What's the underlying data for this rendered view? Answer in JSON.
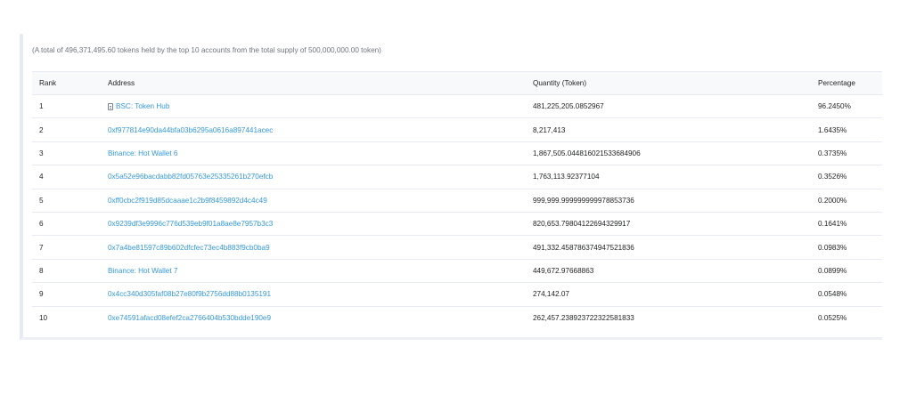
{
  "summary": "(A total of 496,371,495.60 tokens held by the top 10 accounts from the total supply of 500,000,000.00 token)",
  "table": {
    "headers": {
      "rank": "Rank",
      "address": "Address",
      "quantity": "Quantity (Token)",
      "percentage": "Percentage"
    },
    "rows": [
      {
        "rank": "1",
        "address": "BSC: Token Hub",
        "quantity": "481,225,205.0852967",
        "percentage": "96.2450%",
        "icon": "contract-doc-icon"
      },
      {
        "rank": "2",
        "address": "0xf977814e90da44bfa03b6295a0616a897441acec",
        "quantity": "8,217,413",
        "percentage": "1.6435%"
      },
      {
        "rank": "3",
        "address": "Binance: Hot Wallet 6",
        "quantity": "1,867,505.044816021533684906",
        "percentage": "0.3735%"
      },
      {
        "rank": "4",
        "address": "0x5a52e96bacdabb82fd05763e25335261b270efcb",
        "quantity": "1,763,113.92377104",
        "percentage": "0.3526%"
      },
      {
        "rank": "5",
        "address": "0xff0cbc2f919d85dcaaae1c2b9f8459892d4c4c49",
        "quantity": "999,999.999999999978853736",
        "percentage": "0.2000%"
      },
      {
        "rank": "6",
        "address": "0x9239df3e9996c776d539eb9f01a8ae8e7957b3c3",
        "quantity": "820,653.79804122694329917",
        "percentage": "0.1641%"
      },
      {
        "rank": "7",
        "address": "0x7a4be81597c89b602dfcfec73ec4b883f9cb0ba9",
        "quantity": "491,332.458786374947521836",
        "percentage": "0.0983%"
      },
      {
        "rank": "8",
        "address": "Binance: Hot Wallet 7",
        "quantity": "449,672.97668863",
        "percentage": "0.0899%"
      },
      {
        "rank": "9",
        "address": "0x4cc340d305faf08b27e80f9b2756dd88b0135191",
        "quantity": "274,142.07",
        "percentage": "0.0548%"
      },
      {
        "rank": "10",
        "address": "0xe74591afacd08efef2ca2766404b530bdde190e9",
        "quantity": "262,457.238923722322581833",
        "percentage": "0.0525%"
      }
    ]
  }
}
